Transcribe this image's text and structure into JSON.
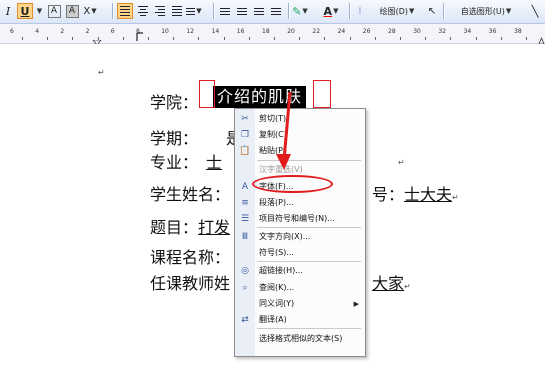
{
  "toolbar": {
    "underline_label": "U",
    "font_a_label": "A",
    "font_a2_label": "A",
    "draw_label": "绘图(D)",
    "autoshape_label": "自选图形(U)",
    "font_color_label": "A"
  },
  "ruler": {
    "numbers": [
      "6",
      "4",
      "2",
      "2",
      "6",
      "8",
      "10",
      "12",
      "14",
      "16",
      "18",
      "20",
      "22",
      "24",
      "26",
      "28",
      "30",
      "32",
      "34",
      "36",
      "38"
    ]
  },
  "document": {
    "row1_label": "学院：",
    "selected_text": "介绍的肌肤",
    "row2_label": "学期：",
    "row2_value": "是",
    "row3_label": "专业：",
    "row3_value": "士",
    "row4_label": "学生姓名：",
    "row4_suffix_label": "号：",
    "row4_suffix_value": "士大夫",
    "row5_label": "题目：",
    "row5_value": "打发",
    "row6_label": "课程名称：",
    "row7_label": "任课教师姓",
    "row7_value": "大家",
    "paragraph_mark": "↵"
  },
  "context_menu": {
    "items": [
      {
        "label": "剪切(T)",
        "icon": "scissors-icon",
        "disabled": false
      },
      {
        "label": "复制(C)",
        "icon": "copy-icon",
        "disabled": false
      },
      {
        "label": "粘贴(P)",
        "icon": "paste-icon",
        "disabled": false
      },
      {
        "label": "汉字重选(V)",
        "icon": "",
        "disabled": true
      },
      {
        "label": "字体(F)...",
        "icon": "font-icon",
        "disabled": false
      },
      {
        "label": "段落(P)...",
        "icon": "paragraph-icon",
        "disabled": false
      },
      {
        "label": "项目符号和编号(N)...",
        "icon": "bullets-icon",
        "disabled": false
      },
      {
        "label": "文字方向(X)...",
        "icon": "text-direction-icon",
        "disabled": false
      },
      {
        "label": "符号(S)...",
        "icon": "",
        "disabled": false
      },
      {
        "label": "超链接(H)...",
        "icon": "hyperlink-icon",
        "disabled": false
      },
      {
        "label": "查阅(K)...",
        "icon": "lookup-icon",
        "disabled": false
      },
      {
        "label": "同义词(Y)",
        "icon": "",
        "disabled": false,
        "submenu": true
      },
      {
        "label": "翻译(A)",
        "icon": "translate-icon",
        "disabled": false
      },
      {
        "label": "选择格式相似的文本(S)",
        "icon": "",
        "disabled": false
      }
    ]
  },
  "annotation_color": "#e01c1c"
}
